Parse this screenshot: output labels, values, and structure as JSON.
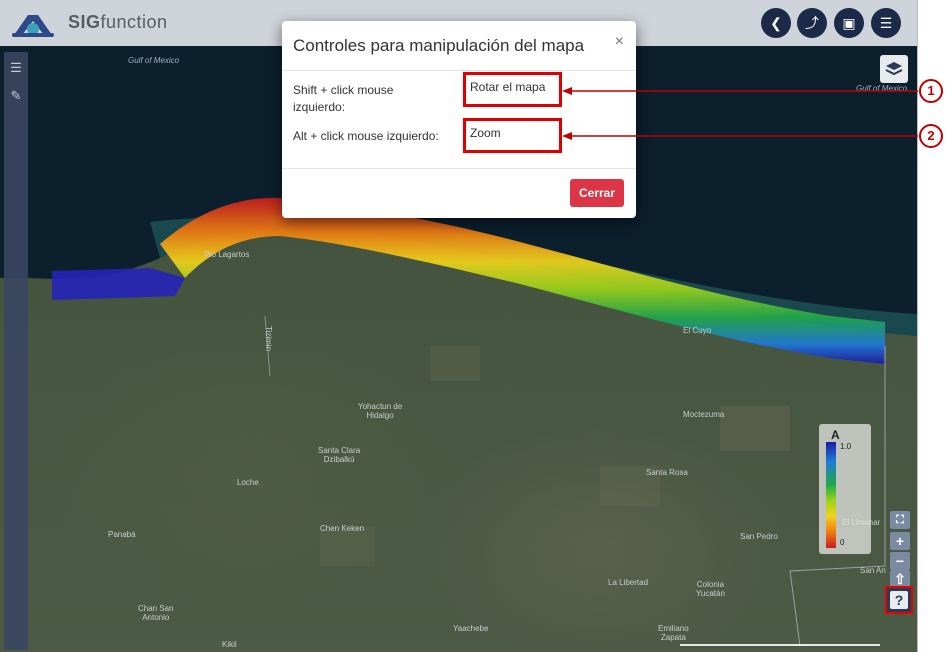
{
  "app": {
    "brand_bold": "SIG",
    "brand_rest": "function"
  },
  "header_buttons": [
    {
      "name": "back-button",
      "icon": "chevron-left-icon",
      "glyph": "❮"
    },
    {
      "name": "share-button",
      "icon": "share-icon",
      "glyph": "⤴"
    },
    {
      "name": "save-button",
      "icon": "save-icon",
      "glyph": "▣"
    },
    {
      "name": "menu-button",
      "icon": "menu-icon",
      "glyph": "☰"
    }
  ],
  "sidebar": {
    "tools_icon": "sliders-icon",
    "brush_icon": "brush-icon"
  },
  "map_labels": {
    "gulf_left": "Gulf of Mexico",
    "gulf_right": "Gulf of Mexico",
    "rio_lagartos": "Rio Lagartos",
    "el_cuyo": "El Cuyo",
    "yohactun": "Yohactun de\nHidalgo",
    "santa_clara": "Santa Clara\nDzibalkú",
    "moctezuma": "Moctezuma",
    "santa_rosa": "Santa Rosa",
    "loche": "Loche",
    "chen_keken": "Chen Keken",
    "san_pedro": "San Pedro",
    "panaba": "Panabá",
    "la_libertad": "La Libertad",
    "colonia_yucatan": "Colonia\nYucatán",
    "chan_san_antonio": "Chan San\nAntonio",
    "yaachebe": "Yaachebe",
    "emiliano_zapata": "Emiliano\nZapata",
    "kikil": "Kikil",
    "san_an": "San An",
    "tizimin_road": "Tizimin",
    "el_limonar": "El Limonar"
  },
  "legend": {
    "title": "A",
    "max": "1.0",
    "min": "0",
    "colors": [
      "#1a1aa6",
      "#1fa84a",
      "#f2d21a",
      "#c81e1e"
    ]
  },
  "zoom_controls": {
    "fullscreen": "⛶",
    "zoom_in": "+",
    "zoom_out": "−",
    "north": "⇧"
  },
  "help": {
    "label": "?"
  },
  "modal": {
    "title": "Controles para manipulación del mapa",
    "close": "×",
    "row1_label": "Shift + click mouse izquierdo:",
    "row1_value": "Rotar el mapa",
    "row2_label": "Alt + click mouse izquierdo:",
    "row2_value": "Zoom",
    "button": "Cerrar"
  },
  "callouts": {
    "one": "1",
    "two": "2"
  },
  "colors": {
    "header_bg": "#cfd4da",
    "header_button_bg": "#1b2a49",
    "danger": "#dc3545",
    "annotation_red": "#e00000"
  }
}
